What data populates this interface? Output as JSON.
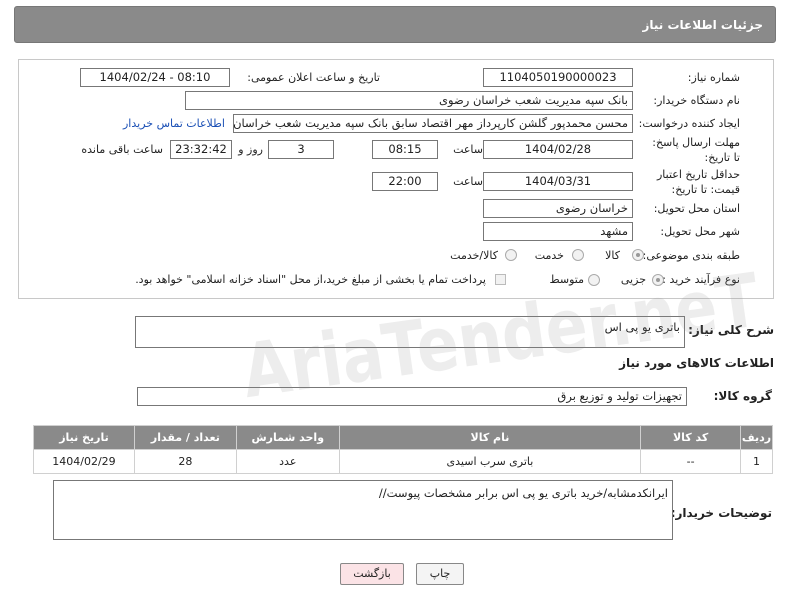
{
  "header": {
    "title": "جزئیات اطلاعات نیاز"
  },
  "form": {
    "need_number_label": "شماره نیاز:",
    "need_number": "1104050190000023",
    "announce_label": "تاریخ و ساعت اعلان عمومی:",
    "announce_value": "1404/02/24 - 08:10",
    "buyer_label": "نام دستگاه خریدار:",
    "buyer_value": "بانک سپه مدیریت شعب خراسان رضوی",
    "creator_label": "ایجاد کننده درخواست:",
    "creator_value": "محسن محمدپور گلشن کارپرداز مهر اقتصاد سابق بانک سپه مدیریت شعب خراسان رضوی",
    "contact_link": "اطلاعات تماس خریدار",
    "deadline_label": "مهلت ارسال پاسخ: تا تاریخ:",
    "deadline_date": "1404/02/28",
    "time_label": "ساعت",
    "deadline_time": "08:15",
    "days_value": "3",
    "days_label": "روز و",
    "remaining_value": "23:32:42",
    "remaining_label": "ساعت باقی مانده",
    "validity_label": "حداقل تاریخ اعتبار قیمت: تا تاریخ:",
    "validity_date": "1404/03/31",
    "validity_time": "22:00",
    "province_label": "استان محل تحویل:",
    "province_value": "خراسان رضوی",
    "city_label": "شهر محل تحویل:",
    "city_value": "مشهد",
    "category_label": "طبقه بندی موضوعی:",
    "category_options": [
      "کالا",
      "خدمت",
      "کالا/خدمت"
    ],
    "process_label": "نوع فرآیند خرید :",
    "process_options": [
      "جزیی",
      "متوسط"
    ],
    "payment_note": "پرداخت تمام یا بخشی از مبلغ خرید،از محل \"اسناد خزانه اسلامی\" خواهد بود."
  },
  "description": {
    "label": "شرح کلی نیاز:",
    "value": "باتری یو پی اس"
  },
  "goods": {
    "section_title": "اطلاعات کالاهای مورد نیاز",
    "group_label": "گروه کالا:",
    "group_value": "تجهیزات تولید و توزیع برق",
    "columns": [
      "ردیف",
      "کد کالا",
      "نام کالا",
      "واحد شمارش",
      "تعداد / مقدار",
      "تاریخ نیاز"
    ],
    "rows": [
      {
        "index": "1",
        "code": "--",
        "name": "باتری سرب اسیدی",
        "unit": "عدد",
        "qty": "28",
        "date": "1404/02/29"
      }
    ]
  },
  "buyer_notes": {
    "label": "توضیحات خریدار:",
    "value": "ایرانکدمشابه/خرید باتری یو پی اس برابر مشخصات پیوست//"
  },
  "buttons": {
    "print": "چاپ",
    "back": "بازگشت"
  },
  "watermark": "AriaTender.neT"
}
